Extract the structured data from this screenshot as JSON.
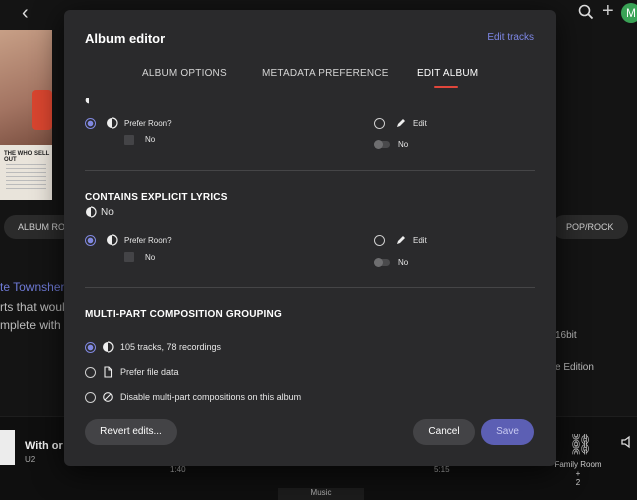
{
  "background": {
    "back_glyph": "‹",
    "plus_glyph": "+",
    "avatar_letter": "M",
    "album_cover_text": "THE WHO SELL OUT",
    "tags": [
      "ALBUM ROC",
      "POP/ROCK"
    ],
    "artist_link": "te Townshen",
    "desc_line1": "rts that would",
    "desc_line2": "mplete with",
    "right_info1": "16bit",
    "right_info2": "xe Edition",
    "now_playing_title": "With or",
    "now_playing_artist": "U2",
    "time_elapsed": "1:40",
    "time_total": "5:15",
    "zone_name": "Family Room +\n2",
    "bottom_tab": "Music"
  },
  "modal": {
    "title": "Album editor",
    "edit_tracks_link": "Edit tracks",
    "tabs": [
      {
        "label": "ALBUM OPTIONS",
        "active": false
      },
      {
        "label": "METADATA PREFERENCE",
        "active": false
      },
      {
        "label": "EDIT ALBUM",
        "active": true
      }
    ],
    "accent_color": "#e0463b",
    "link_color": "#7d87e6",
    "section_top": {
      "prefer_roon_label": "Prefer Roon?",
      "prefer_roon_value": "No",
      "edit_label": "Edit",
      "edit_value": "No"
    },
    "section_explicit": {
      "heading": "CONTAINS EXPLICIT LYRICS",
      "current_value": "No",
      "prefer_roon_label": "Prefer Roon?",
      "prefer_roon_value": "No",
      "edit_label": "Edit",
      "edit_value": "No"
    },
    "section_multipart": {
      "heading": "MULTI-PART COMPOSITION GROUPING",
      "options": [
        {
          "label": "105 tracks, 78 recordings",
          "selected": true,
          "icon": "roon-icon"
        },
        {
          "label": "Prefer file data",
          "selected": false,
          "icon": "file-icon"
        },
        {
          "label": "Disable multi-part compositions on this album",
          "selected": false,
          "icon": "disabled-icon"
        }
      ]
    },
    "footer": {
      "revert_label": "Revert edits...",
      "cancel_label": "Cancel",
      "save_label": "Save"
    }
  }
}
